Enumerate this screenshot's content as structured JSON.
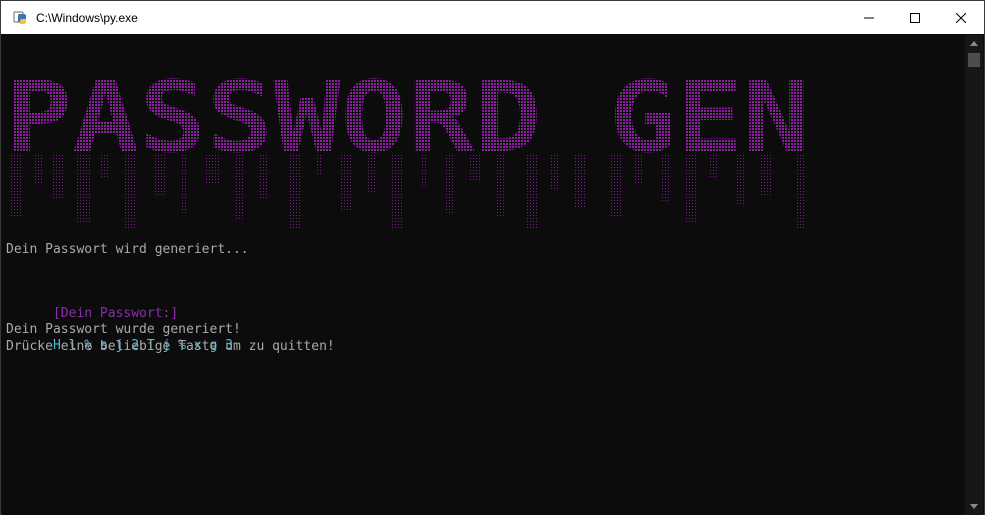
{
  "window": {
    "title": "C:\\Windows\\py.exe",
    "controls": [
      "minimize",
      "maximize",
      "close"
    ]
  },
  "banner": {
    "text": "PASSWORD GEN",
    "color": "#8e1fa3"
  },
  "console": {
    "status_generating": "Dein Passwort wird generiert...",
    "password_label": "[Dein Passwort:]",
    "password_value": "H l % s j 2 T j % x g 3",
    "status_done": "Dein Passwort wurde generiert!",
    "status_exit": "Drücke eine beliebige Taste um zu quitten!"
  },
  "colors": {
    "background": "#0c0c0c",
    "text": "#a9a9a9",
    "label": "#8e2ea5",
    "password": "#4fb8d6"
  },
  "icons": {
    "app": "python-launcher-icon",
    "minimize": "minimize-icon",
    "maximize": "maximize-icon",
    "close": "close-icon",
    "scroll_up": "scroll-up-arrow-icon",
    "scroll_down": "scroll-down-arrow-icon"
  }
}
